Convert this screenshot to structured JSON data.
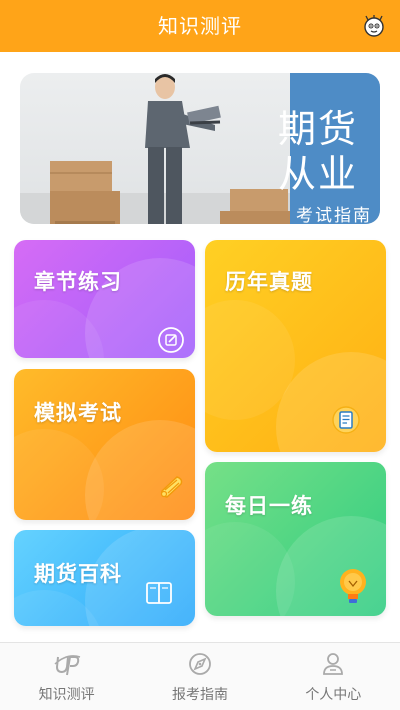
{
  "header": {
    "title": "知识测评",
    "icon": "mascot-icon"
  },
  "banner": {
    "title_line1": "期货",
    "title_line2": "从业",
    "subtitle": "考试指南"
  },
  "cards": [
    {
      "label": "章节练习",
      "icon": "edit-icon",
      "color": "#b463fa"
    },
    {
      "label": "历年真题",
      "icon": "document-icon",
      "color": "#ffbd1a"
    },
    {
      "label": "模拟考试",
      "icon": "scroll-icon",
      "color": "#ff9d1c"
    },
    {
      "label": "每日一练",
      "icon": "lightbulb-icon",
      "color": "#45d383"
    },
    {
      "label": "期货百科",
      "icon": "book-icon",
      "color": "#45bcfc"
    }
  ],
  "tabbar": {
    "items": [
      {
        "label": "知识测评",
        "icon": "up-logo-icon"
      },
      {
        "label": "报考指南",
        "icon": "compass-icon"
      },
      {
        "label": "个人中心",
        "icon": "person-icon"
      }
    ]
  },
  "colors": {
    "accent": "#ffa418",
    "banner_panel": "#4e8cc6"
  }
}
